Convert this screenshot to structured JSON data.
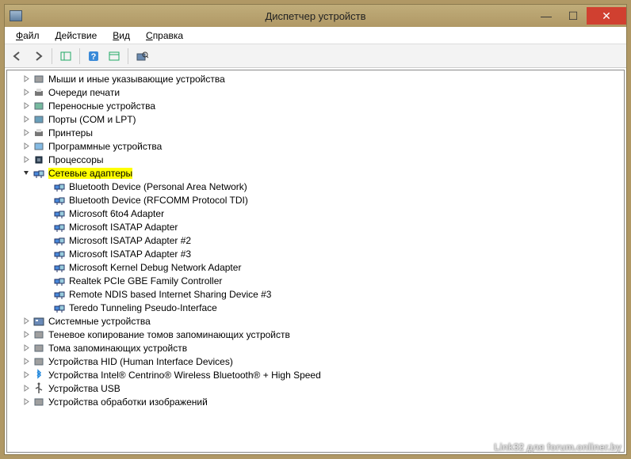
{
  "window": {
    "title": "Диспетчер устройств"
  },
  "menu": {
    "file": "Файл",
    "action": "Действие",
    "view": "Вид",
    "help": "Справка"
  },
  "tree": [
    {
      "label": "Мыши и иные указывающие устройства",
      "expanded": false,
      "icon": "mouse"
    },
    {
      "label": "Очереди печати",
      "expanded": false,
      "icon": "printer"
    },
    {
      "label": "Переносные устройства",
      "expanded": false,
      "icon": "portable"
    },
    {
      "label": "Порты (COM и LPT)",
      "expanded": false,
      "icon": "port"
    },
    {
      "label": "Принтеры",
      "expanded": false,
      "icon": "printer"
    },
    {
      "label": "Программные устройства",
      "expanded": false,
      "icon": "software"
    },
    {
      "label": "Процессоры",
      "expanded": false,
      "icon": "cpu"
    },
    {
      "label": "Сетевые адаптеры",
      "expanded": true,
      "icon": "net",
      "highlight": true,
      "children": [
        {
          "label": "Bluetooth Device (Personal Area Network)",
          "icon": "net"
        },
        {
          "label": "Bluetooth Device (RFCOMM Protocol TDI)",
          "icon": "net"
        },
        {
          "label": "Microsoft 6to4 Adapter",
          "icon": "net"
        },
        {
          "label": "Microsoft ISATAP Adapter",
          "icon": "net"
        },
        {
          "label": "Microsoft ISATAP Adapter #2",
          "icon": "net"
        },
        {
          "label": "Microsoft ISATAP Adapter #3",
          "icon": "net"
        },
        {
          "label": "Microsoft Kernel Debug Network Adapter",
          "icon": "net"
        },
        {
          "label": "Realtek PCIe GBE Family Controller",
          "icon": "net"
        },
        {
          "label": "Remote NDIS based Internet Sharing Device #3",
          "icon": "net"
        },
        {
          "label": "Teredo Tunneling Pseudo-Interface",
          "icon": "net"
        }
      ]
    },
    {
      "label": "Системные устройства",
      "expanded": false,
      "icon": "system"
    },
    {
      "label": "Теневое копирование томов запоминающих устройств",
      "expanded": false,
      "icon": "shadow"
    },
    {
      "label": "Тома запоминающих устройств",
      "expanded": false,
      "icon": "volume"
    },
    {
      "label": "Устройства HID (Human Interface Devices)",
      "expanded": false,
      "icon": "hid"
    },
    {
      "label": "Устройства Intel® Centrino® Wireless Bluetooth® + High Speed",
      "expanded": false,
      "icon": "bt"
    },
    {
      "label": "Устройства USB",
      "expanded": false,
      "icon": "usb"
    },
    {
      "label": "Устройства обработки изображений",
      "expanded": false,
      "icon": "image"
    }
  ],
  "watermark": "Link32 для forum.onliner.by"
}
